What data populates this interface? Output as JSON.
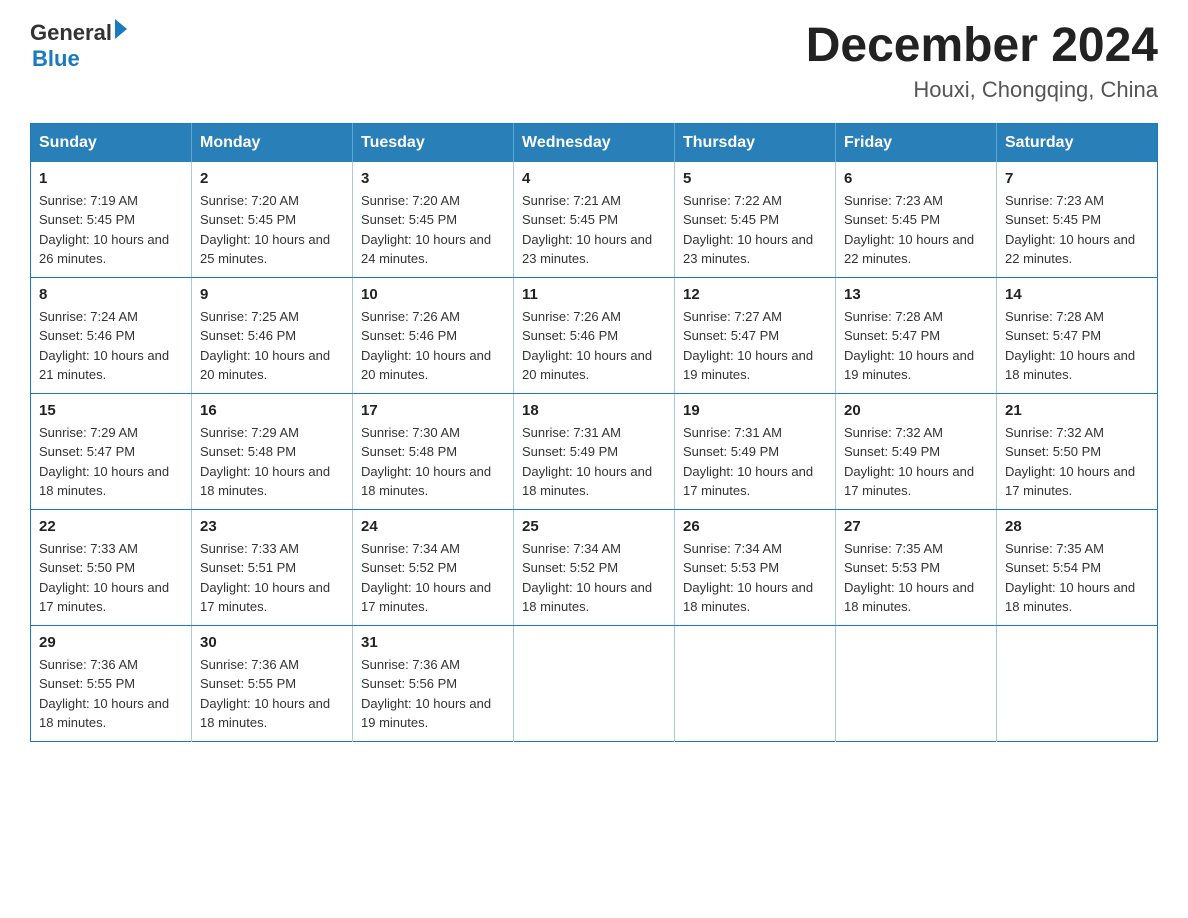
{
  "header": {
    "logo_general": "General",
    "logo_blue": "Blue",
    "month_title": "December 2024",
    "location": "Houxi, Chongqing, China"
  },
  "days_of_week": [
    "Sunday",
    "Monday",
    "Tuesday",
    "Wednesday",
    "Thursday",
    "Friday",
    "Saturday"
  ],
  "weeks": [
    [
      {
        "day": "1",
        "sunrise": "7:19 AM",
        "sunset": "5:45 PM",
        "daylight": "10 hours and 26 minutes."
      },
      {
        "day": "2",
        "sunrise": "7:20 AM",
        "sunset": "5:45 PM",
        "daylight": "10 hours and 25 minutes."
      },
      {
        "day": "3",
        "sunrise": "7:20 AM",
        "sunset": "5:45 PM",
        "daylight": "10 hours and 24 minutes."
      },
      {
        "day": "4",
        "sunrise": "7:21 AM",
        "sunset": "5:45 PM",
        "daylight": "10 hours and 23 minutes."
      },
      {
        "day": "5",
        "sunrise": "7:22 AM",
        "sunset": "5:45 PM",
        "daylight": "10 hours and 23 minutes."
      },
      {
        "day": "6",
        "sunrise": "7:23 AM",
        "sunset": "5:45 PM",
        "daylight": "10 hours and 22 minutes."
      },
      {
        "day": "7",
        "sunrise": "7:23 AM",
        "sunset": "5:45 PM",
        "daylight": "10 hours and 22 minutes."
      }
    ],
    [
      {
        "day": "8",
        "sunrise": "7:24 AM",
        "sunset": "5:46 PM",
        "daylight": "10 hours and 21 minutes."
      },
      {
        "day": "9",
        "sunrise": "7:25 AM",
        "sunset": "5:46 PM",
        "daylight": "10 hours and 20 minutes."
      },
      {
        "day": "10",
        "sunrise": "7:26 AM",
        "sunset": "5:46 PM",
        "daylight": "10 hours and 20 minutes."
      },
      {
        "day": "11",
        "sunrise": "7:26 AM",
        "sunset": "5:46 PM",
        "daylight": "10 hours and 20 minutes."
      },
      {
        "day": "12",
        "sunrise": "7:27 AM",
        "sunset": "5:47 PM",
        "daylight": "10 hours and 19 minutes."
      },
      {
        "day": "13",
        "sunrise": "7:28 AM",
        "sunset": "5:47 PM",
        "daylight": "10 hours and 19 minutes."
      },
      {
        "day": "14",
        "sunrise": "7:28 AM",
        "sunset": "5:47 PM",
        "daylight": "10 hours and 18 minutes."
      }
    ],
    [
      {
        "day": "15",
        "sunrise": "7:29 AM",
        "sunset": "5:47 PM",
        "daylight": "10 hours and 18 minutes."
      },
      {
        "day": "16",
        "sunrise": "7:29 AM",
        "sunset": "5:48 PM",
        "daylight": "10 hours and 18 minutes."
      },
      {
        "day": "17",
        "sunrise": "7:30 AM",
        "sunset": "5:48 PM",
        "daylight": "10 hours and 18 minutes."
      },
      {
        "day": "18",
        "sunrise": "7:31 AM",
        "sunset": "5:49 PM",
        "daylight": "10 hours and 18 minutes."
      },
      {
        "day": "19",
        "sunrise": "7:31 AM",
        "sunset": "5:49 PM",
        "daylight": "10 hours and 17 minutes."
      },
      {
        "day": "20",
        "sunrise": "7:32 AM",
        "sunset": "5:49 PM",
        "daylight": "10 hours and 17 minutes."
      },
      {
        "day": "21",
        "sunrise": "7:32 AM",
        "sunset": "5:50 PM",
        "daylight": "10 hours and 17 minutes."
      }
    ],
    [
      {
        "day": "22",
        "sunrise": "7:33 AM",
        "sunset": "5:50 PM",
        "daylight": "10 hours and 17 minutes."
      },
      {
        "day": "23",
        "sunrise": "7:33 AM",
        "sunset": "5:51 PM",
        "daylight": "10 hours and 17 minutes."
      },
      {
        "day": "24",
        "sunrise": "7:34 AM",
        "sunset": "5:52 PM",
        "daylight": "10 hours and 17 minutes."
      },
      {
        "day": "25",
        "sunrise": "7:34 AM",
        "sunset": "5:52 PM",
        "daylight": "10 hours and 18 minutes."
      },
      {
        "day": "26",
        "sunrise": "7:34 AM",
        "sunset": "5:53 PM",
        "daylight": "10 hours and 18 minutes."
      },
      {
        "day": "27",
        "sunrise": "7:35 AM",
        "sunset": "5:53 PM",
        "daylight": "10 hours and 18 minutes."
      },
      {
        "day": "28",
        "sunrise": "7:35 AM",
        "sunset": "5:54 PM",
        "daylight": "10 hours and 18 minutes."
      }
    ],
    [
      {
        "day": "29",
        "sunrise": "7:36 AM",
        "sunset": "5:55 PM",
        "daylight": "10 hours and 18 minutes."
      },
      {
        "day": "30",
        "sunrise": "7:36 AM",
        "sunset": "5:55 PM",
        "daylight": "10 hours and 18 minutes."
      },
      {
        "day": "31",
        "sunrise": "7:36 AM",
        "sunset": "5:56 PM",
        "daylight": "10 hours and 19 minutes."
      },
      null,
      null,
      null,
      null
    ]
  ]
}
